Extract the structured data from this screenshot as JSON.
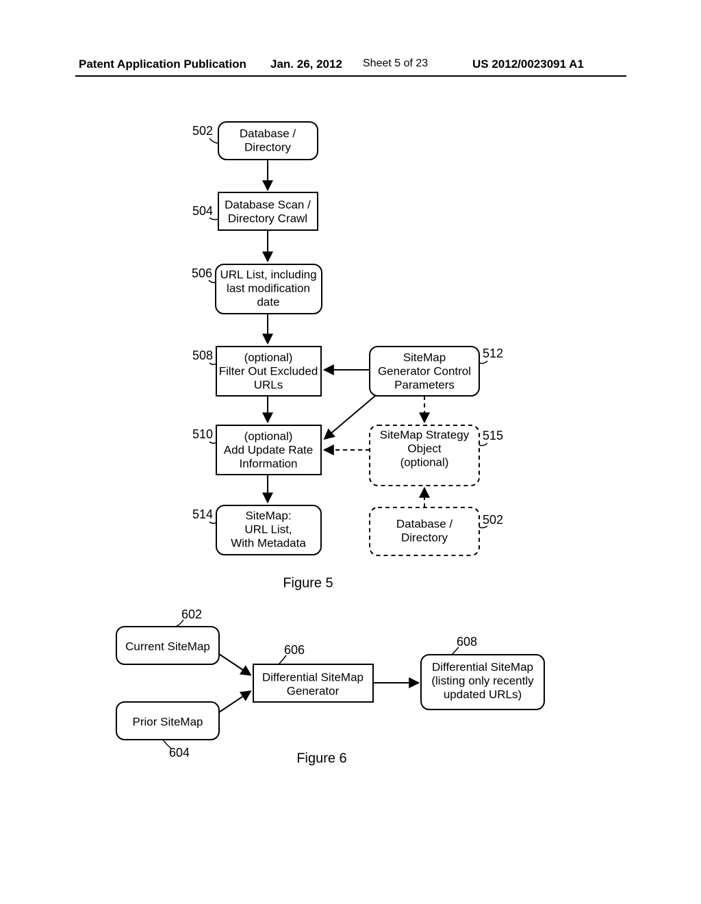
{
  "header": {
    "publication": "Patent Application Publication",
    "date": "Jan. 26, 2012",
    "sheet": "Sheet 5 of 23",
    "docid": "US 2012/0023091 A1"
  },
  "fig5": {
    "caption": "Figure 5",
    "refs": {
      "r502": "502",
      "r504": "504",
      "r506": "506",
      "r508": "508",
      "r510": "510",
      "r512": "512",
      "r514": "514",
      "r515": "515",
      "r502b": "502"
    },
    "boxes": {
      "b502": {
        "l1": "Database /",
        "l2": "Directory"
      },
      "b504": {
        "l1": "Database Scan /",
        "l2": "Directory Crawl"
      },
      "b506": {
        "l1": "URL List, including",
        "l2": "last modification",
        "l3": "date"
      },
      "b508": {
        "l1": "(optional)",
        "l2": "Filter Out Excluded",
        "l3": "URLs"
      },
      "b510": {
        "l1": "(optional)",
        "l2": "Add Update Rate",
        "l3": "Information"
      },
      "b512": {
        "l1": "SiteMap",
        "l2": "Generator Control",
        "l3": "Parameters"
      },
      "b514": {
        "l1": "SiteMap:",
        "l2": "URL List,",
        "l3": "With Metadata"
      },
      "b515": {
        "l1": "SiteMap Strategy",
        "l2": "Object",
        "l3": "(optional)"
      },
      "b502b": {
        "l1": "Database /",
        "l2": "Directory"
      }
    }
  },
  "fig6": {
    "caption": "Figure 6",
    "refs": {
      "r602": "602",
      "r604": "604",
      "r606": "606",
      "r608": "608"
    },
    "boxes": {
      "b602": {
        "l1": "Current SiteMap"
      },
      "b604": {
        "l1": "Prior SiteMap"
      },
      "b606": {
        "l1": "Differential SiteMap",
        "l2": "Generator"
      },
      "b608": {
        "l1": "Differential SiteMap",
        "l2": "(listing only recently",
        "l3": "updated URLs)"
      }
    }
  }
}
